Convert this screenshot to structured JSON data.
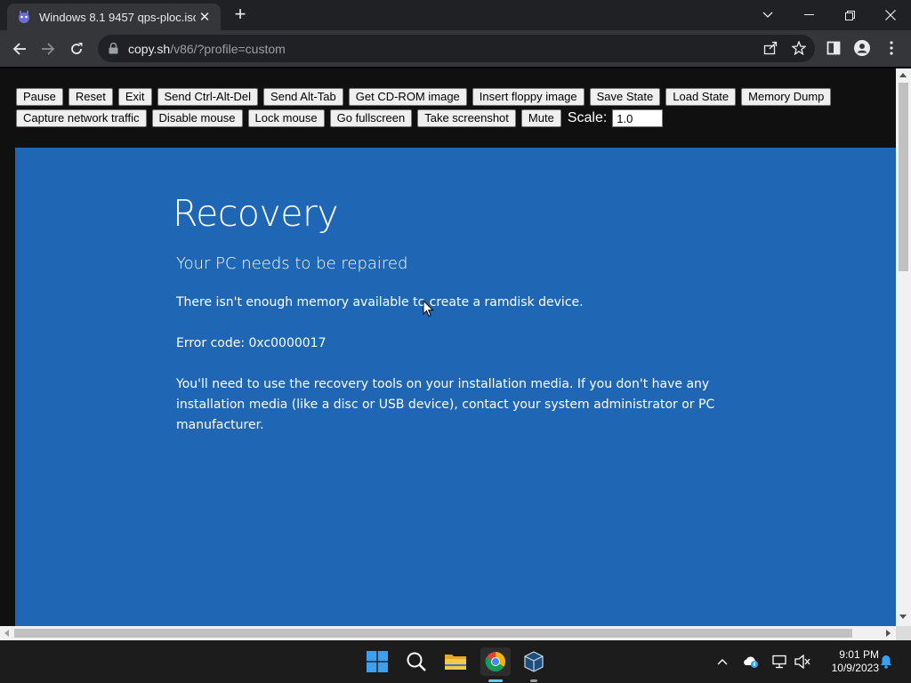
{
  "browser": {
    "tab_title": "Windows 8.1 9457 qps-ploc.iso",
    "tab_close": "✕",
    "new_tab": "+",
    "url_host": "copy.sh",
    "url_path": "/v86/?profile=custom",
    "icons": [
      "back-arrow-icon",
      "forward-arrow-icon",
      "reload-icon",
      "lock-icon",
      "share-icon",
      "star-icon",
      "sidebar-icon",
      "profile-icon",
      "menu-icon"
    ]
  },
  "controls": {
    "row1": [
      "Pause",
      "Reset",
      "Exit",
      "Send Ctrl-Alt-Del",
      "Send Alt-Tab",
      "Get CD-ROM image",
      "Insert floppy image",
      "Save State",
      "Load State",
      "Memory Dump"
    ],
    "row2": [
      "Capture network traffic",
      "Disable mouse",
      "Lock mouse",
      "Go fullscreen",
      "Take screenshot",
      "Mute"
    ],
    "scale_label": "Scale:",
    "scale_value": "1.0"
  },
  "recovery": {
    "title": "Recovery",
    "subtitle": "Your PC needs to be repaired",
    "message": "There isn't enough memory available to create a ramdisk device.",
    "error_code": "Error code: 0xc0000017",
    "instructions": "You'll need to use the recovery tools on your installation media. If you don't have any installation media (like a disc or USB device), contact your system administrator or PC manufacturer."
  },
  "taskbar": {
    "time": "9:01 PM",
    "date": "10/9/2023",
    "apps": [
      "start-icon",
      "search-icon",
      "file-explorer-icon",
      "chrome-icon",
      "virtualbox-icon"
    ]
  },
  "colors": {
    "recovery_blue": "#1f67b4",
    "page_bg": "#101010",
    "chrome_dark": "#202124"
  }
}
